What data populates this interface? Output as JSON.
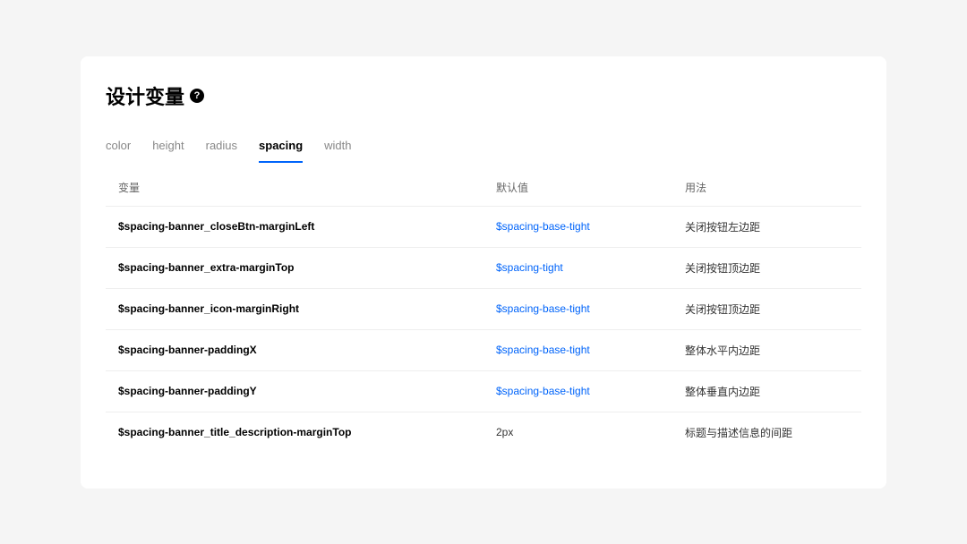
{
  "header": {
    "title": "设计变量",
    "help_symbol": "?"
  },
  "tabs": [
    {
      "label": "color",
      "active": false
    },
    {
      "label": "height",
      "active": false
    },
    {
      "label": "radius",
      "active": false
    },
    {
      "label": "spacing",
      "active": true
    },
    {
      "label": "width",
      "active": false
    }
  ],
  "table": {
    "columns": {
      "variable": "变量",
      "default_value": "默认值",
      "usage": "用法"
    },
    "rows": [
      {
        "variable": "$spacing-banner_closeBtn-marginLeft",
        "default_value": "$spacing-base-tight",
        "default_is_link": true,
        "usage": "关闭按钮左边距"
      },
      {
        "variable": "$spacing-banner_extra-marginTop",
        "default_value": "$spacing-tight",
        "default_is_link": true,
        "usage": "关闭按钮顶边距"
      },
      {
        "variable": "$spacing-banner_icon-marginRight",
        "default_value": "$spacing-base-tight",
        "default_is_link": true,
        "usage": "关闭按钮顶边距"
      },
      {
        "variable": "$spacing-banner-paddingX",
        "default_value": "$spacing-base-tight",
        "default_is_link": true,
        "usage": "整体水平内边距"
      },
      {
        "variable": "$spacing-banner-paddingY",
        "default_value": "$spacing-base-tight",
        "default_is_link": true,
        "usage": "整体垂直内边距"
      },
      {
        "variable": "$spacing-banner_title_description-marginTop",
        "default_value": "2px",
        "default_is_link": false,
        "usage": "标题与描述信息的间距"
      }
    ]
  }
}
